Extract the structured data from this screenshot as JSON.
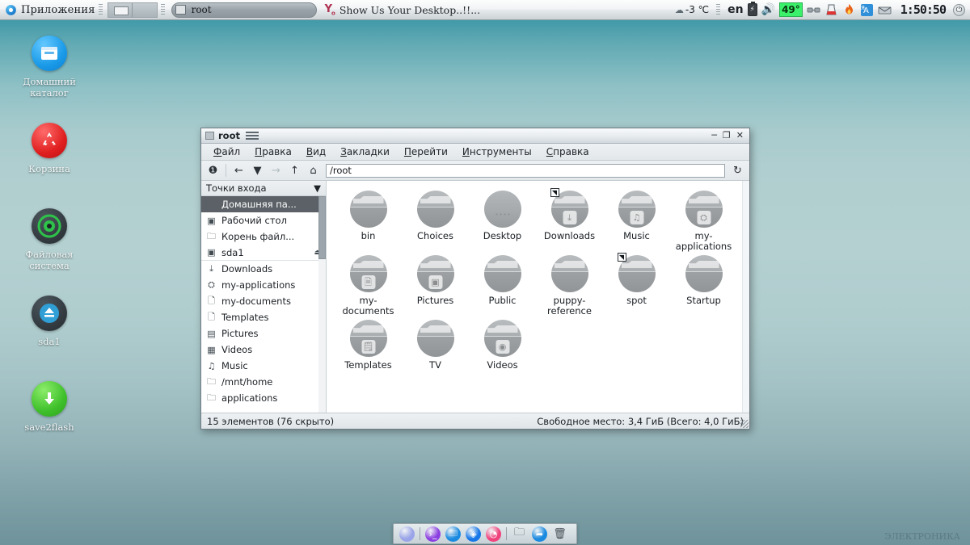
{
  "taskbar": {
    "menu_label": "Приложения",
    "pager": {
      "pages": 2,
      "active_index": 0
    },
    "task_button": {
      "label": "root"
    },
    "news_ticker": {
      "icon": "yahoo-icon",
      "text": "Show Us Your Desktop..!!..."
    },
    "tray": {
      "weather_icon": "cloud-icon",
      "weather_temp": "-3 ℃",
      "keyboard_layout": "en",
      "battery_icon": "battery-icon",
      "volume_icon": "speaker-icon",
      "cpu_temp": "49°",
      "network_icon": "network-icon",
      "diskmon_icon": "beaker-icon",
      "firewall_icon": "flame-icon",
      "translate_icon": "translate-icon",
      "mail_icon": "mail-icon",
      "clock": "1:50:50",
      "power_icon": "power-icon"
    }
  },
  "desktop": {
    "icons": [
      {
        "name": "Домашний каталог",
        "icon": "home-folder-icon",
        "glyph": "▤",
        "cls": "ic-home"
      },
      {
        "name": "Корзина",
        "icon": "trash-recycle-icon",
        "glyph": "♲",
        "cls": "ic-trash"
      },
      {
        "name": "Файловая система",
        "icon": "filesystem-disc-icon",
        "glyph": "◉",
        "cls": "ic-fs"
      },
      {
        "name": "sda1",
        "icon": "eject-drive-icon",
        "glyph": "⏏",
        "cls": "ic-sda"
      },
      {
        "name": "save2flash",
        "icon": "save-download-icon",
        "glyph": "⬇",
        "cls": "ic-save"
      }
    ],
    "watermark": "ЭЛЕКТРОНИКА"
  },
  "file_manager": {
    "title": "root",
    "window_buttons": {
      "minimize": "─",
      "maximize": "❐",
      "close": "✕"
    },
    "menus": [
      {
        "label": "Файл",
        "mnemonic": "Ф"
      },
      {
        "label": "Правка",
        "mnemonic": "П"
      },
      {
        "label": "Вид",
        "mnemonic": "В"
      },
      {
        "label": "Закладки",
        "mnemonic": "З"
      },
      {
        "label": "Перейти",
        "mnemonic": "П"
      },
      {
        "label": "Инструменты",
        "mnemonic": "И"
      },
      {
        "label": "Справка",
        "mnemonic": "С"
      }
    ],
    "toolbar": {
      "info": "❶",
      "back": "←",
      "history": "▼",
      "forward": "→",
      "up": "↑",
      "home": "⌂",
      "refresh": "↻"
    },
    "path": "/root",
    "sidebar": {
      "header": "Точки входа",
      "collapse_icon": "▼",
      "items": [
        {
          "label": "Домашняя па...",
          "icon": "home-icon",
          "glyph": "",
          "selected": true,
          "group": 1
        },
        {
          "label": "Рабочий стол",
          "icon": "desktop-icon",
          "glyph": "▣",
          "selected": false,
          "group": 1
        },
        {
          "label": "Корень файл...",
          "icon": "folder-icon",
          "glyph": "🗀",
          "selected": false,
          "group": 1
        },
        {
          "label": "sda1",
          "icon": "drive-icon",
          "glyph": "▣",
          "selected": false,
          "group": 1,
          "eject": "⏏"
        },
        {
          "label": "Downloads",
          "icon": "download-icon",
          "glyph": "⤓",
          "selected": false,
          "group": 2
        },
        {
          "label": "my-applications",
          "icon": "applications-icon",
          "glyph": "⛭",
          "selected": false,
          "group": 2
        },
        {
          "label": "my-documents",
          "icon": "document-icon",
          "glyph": "🗋",
          "selected": false,
          "group": 2
        },
        {
          "label": "Templates",
          "icon": "template-icon",
          "glyph": "🗋",
          "selected": false,
          "group": 2
        },
        {
          "label": "Pictures",
          "icon": "pictures-icon",
          "glyph": "▤",
          "selected": false,
          "group": 2
        },
        {
          "label": "Videos",
          "icon": "videos-icon",
          "glyph": "▦",
          "selected": false,
          "group": 2
        },
        {
          "label": "Music",
          "icon": "music-icon",
          "glyph": "♫",
          "selected": false,
          "group": 2
        },
        {
          "label": "/mnt/home",
          "icon": "folder-icon",
          "glyph": "🗀",
          "selected": false,
          "group": 2
        },
        {
          "label": "applications",
          "icon": "folder-icon",
          "glyph": "🗀",
          "selected": false,
          "group": 2
        }
      ]
    },
    "files": [
      {
        "name": "bin",
        "type": "folder",
        "emblem": null,
        "symlink": false
      },
      {
        "name": "Choices",
        "type": "folder",
        "emblem": null,
        "symlink": false
      },
      {
        "name": "Desktop",
        "type": "disc",
        "emblem": null,
        "symlink": false
      },
      {
        "name": "Downloads",
        "type": "folder",
        "emblem": "⤓",
        "symlink": true
      },
      {
        "name": "Music",
        "type": "folder",
        "emblem": "♫",
        "symlink": false
      },
      {
        "name": "my-applications",
        "type": "folder",
        "emblem": "⛭",
        "symlink": false
      },
      {
        "name": "my-documents",
        "type": "folder",
        "emblem": "🗎",
        "symlink": false
      },
      {
        "name": "Pictures",
        "type": "folder",
        "emblem": "▣",
        "symlink": false
      },
      {
        "name": "Public",
        "type": "folder",
        "emblem": null,
        "symlink": false
      },
      {
        "name": "puppy-reference",
        "type": "folder",
        "emblem": null,
        "symlink": false
      },
      {
        "name": "spot",
        "type": "folder",
        "emblem": null,
        "symlink": true
      },
      {
        "name": "Startup",
        "type": "folder",
        "emblem": null,
        "symlink": false
      },
      {
        "name": "Templates",
        "type": "folder",
        "emblem": "🗒",
        "symlink": false
      },
      {
        "name": "TV",
        "type": "folder",
        "emblem": null,
        "symlink": false
      },
      {
        "name": "Videos",
        "type": "folder",
        "emblem": "◉",
        "symlink": false
      }
    ],
    "status": {
      "left": "15 элементов (76 скрыто)",
      "right": "Свободное место: 3,4 ГиБ (Всего: 4,0 ГиБ)"
    }
  },
  "dock": {
    "items": [
      {
        "name": "pager-preview",
        "icon": "circle-icon",
        "glyph": "",
        "color": "#9aa4e8",
        "flat": false
      },
      {
        "name": "separator-1",
        "icon": "separator",
        "glyph": "",
        "color": "",
        "flat": "sep"
      },
      {
        "name": "terminal",
        "icon": "terminal-icon",
        "glyph": "›_",
        "color": "#8b3ee0",
        "flat": false
      },
      {
        "name": "file-manager",
        "icon": "folder-icon",
        "glyph": "🗀",
        "color": "#1a8ae0",
        "flat": false
      },
      {
        "name": "browser",
        "icon": "compass-icon",
        "glyph": "◈",
        "color": "#1878e8",
        "flat": false
      },
      {
        "name": "clock-app",
        "icon": "clock-icon",
        "glyph": "◔",
        "color": "#f0437c",
        "flat": false
      },
      {
        "name": "separator-2",
        "icon": "separator",
        "glyph": "",
        "color": "",
        "flat": "sep"
      },
      {
        "name": "folder-shortcut",
        "icon": "folder-outline-icon",
        "glyph": "🗀",
        "color": "",
        "flat": true
      },
      {
        "name": "share",
        "icon": "share-icon",
        "glyph": "➦",
        "color": "#1a8ae0",
        "flat": false
      },
      {
        "name": "trash-shortcut",
        "icon": "trash-icon",
        "glyph": "🗑",
        "color": "",
        "flat": true
      }
    ]
  },
  "colors": {
    "accent_blue": "#1a8ae0",
    "cpu_badge_green": "#3bf06a",
    "selection_gray": "#5b6166",
    "desktop_top": "#2d8799",
    "desktop_bottom": "#6f939b"
  }
}
